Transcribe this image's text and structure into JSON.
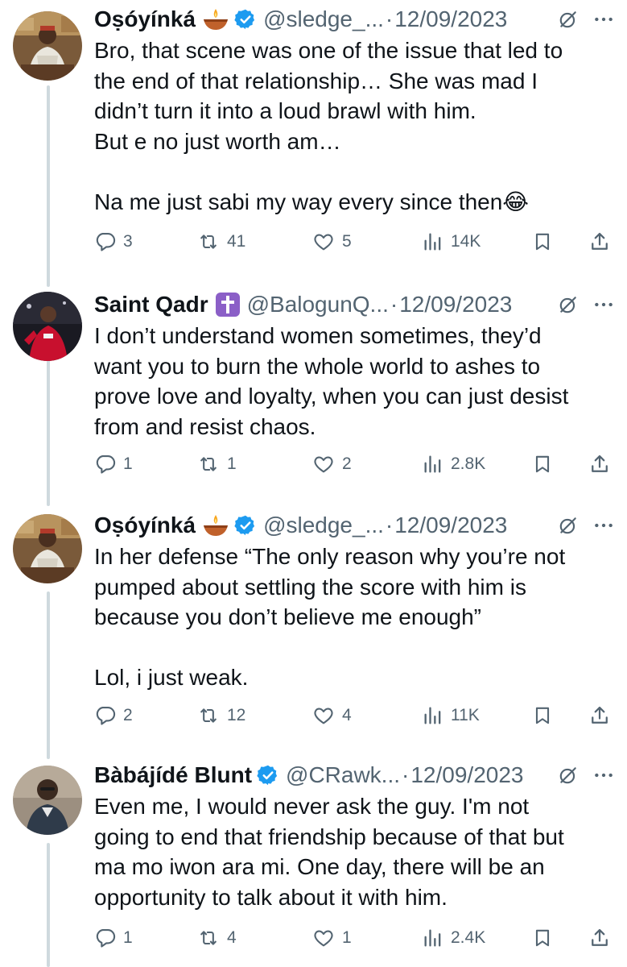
{
  "tweets": [
    {
      "name": "Oṣóyínká",
      "emoji": "diya-lamp-icon",
      "badge": "verified-blue",
      "handle": "@sledge_...",
      "date": "12/09/2023",
      "lines": [
        "Bro, that scene was one of the issue that led to",
        "the end of that relationship… She was mad I",
        "didn’t turn it into a loud brawl with him.",
        "But e no just worth am…",
        "",
        "Na me just sabi my way every since then😂"
      ],
      "replies": "3",
      "retweets": "41",
      "likes": "5",
      "views": "14K"
    },
    {
      "name": "Saint Qadr",
      "emoji": "latin-cross-icon",
      "badge": "",
      "handle": "@BalogunQ...",
      "date": "12/09/2023",
      "lines": [
        "I don’t understand women sometimes, they’d",
        "want you to burn the whole world to ashes to",
        "prove love and loyalty, when you can just desist",
        "from and resist chaos."
      ],
      "replies": "1",
      "retweets": "1",
      "likes": "2",
      "views": "2.8K"
    },
    {
      "name": "Oṣóyínká",
      "emoji": "diya-lamp-icon",
      "badge": "verified-blue",
      "handle": "@sledge_...",
      "date": "12/09/2023",
      "lines": [
        "In her defense “The only reason why you’re not",
        "pumped about settling the score with him is",
        "because you don’t believe me enough”",
        "",
        "Lol, i just weak."
      ],
      "replies": "2",
      "retweets": "12",
      "likes": "4",
      "views": "11K"
    },
    {
      "name": "Bàbájídé Blunt",
      "emoji": "",
      "badge": "verified-blue",
      "handle": "@CRawk...",
      "date": "12/09/2023",
      "lines": [
        "Even me, I would never ask the guy. I'm not",
        "going to end that friendship because of that but",
        "ma mo iwon ara mi. One day, there will be an",
        "opportunity to talk about it with him."
      ],
      "replies": "1",
      "retweets": "4",
      "likes": "1",
      "views": "2.4K"
    }
  ],
  "separator": "·",
  "colors": {
    "text": "#0f1419",
    "secondary": "#536471",
    "verified": "#1d9bf0",
    "thread_line": "#cfd9de",
    "cross_badge": "#8b5fc7"
  }
}
